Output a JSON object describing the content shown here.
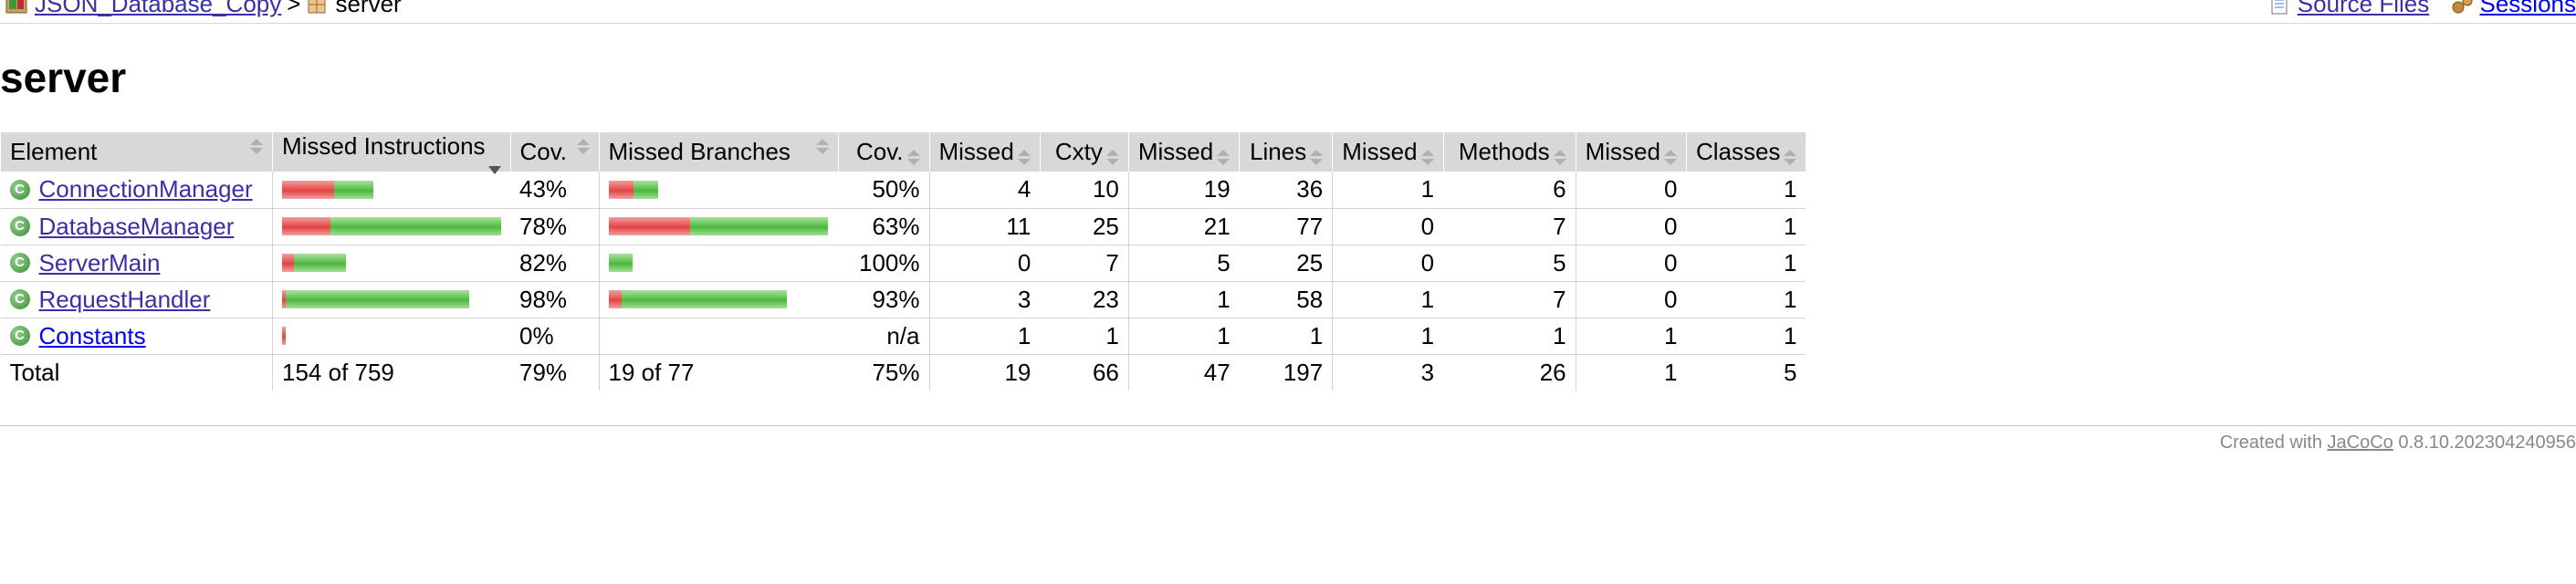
{
  "breadcrumb": {
    "project": "JSON_Database_Copy",
    "separator": ">",
    "current": "server",
    "source_files": "Source Files",
    "sessions": "Sessions"
  },
  "page_title": "server",
  "table": {
    "headers": [
      "Element",
      "Missed Instructions",
      "Cov.",
      "Missed Branches",
      "Cov.",
      "Missed",
      "Cxty",
      "Missed",
      "Lines",
      "Missed",
      "Methods",
      "Missed",
      "Classes"
    ],
    "rows": [
      {
        "name": "ConnectionManager",
        "instr_missed_frac": 0.57,
        "instr_cov": "43%",
        "br_missed_frac": 0.5,
        "br_cov": "50%",
        "cxty_missed": "4",
        "cxty": "10",
        "lines_missed": "19",
        "lines": "36",
        "methods_missed": "1",
        "methods": "6",
        "classes_missed": "0",
        "classes": "1",
        "visited": true
      },
      {
        "name": "DatabaseManager",
        "instr_missed_frac": 0.22,
        "instr_cov": "78%",
        "br_missed_frac": 0.37,
        "br_cov": "63%",
        "cxty_missed": "11",
        "cxty": "25",
        "lines_missed": "21",
        "lines": "77",
        "methods_missed": "0",
        "methods": "7",
        "classes_missed": "0",
        "classes": "1",
        "visited": true
      },
      {
        "name": "ServerMain",
        "instr_missed_frac": 0.18,
        "instr_cov": "82%",
        "br_missed_frac": 0.0,
        "br_cov": "100%",
        "cxty_missed": "0",
        "cxty": "7",
        "lines_missed": "5",
        "lines": "25",
        "methods_missed": "0",
        "methods": "5",
        "classes_missed": "0",
        "classes": "1",
        "visited": true
      },
      {
        "name": "RequestHandler",
        "instr_missed_frac": 0.02,
        "instr_cov": "98%",
        "br_missed_frac": 0.07,
        "br_cov": "93%",
        "cxty_missed": "3",
        "cxty": "23",
        "lines_missed": "1",
        "lines": "58",
        "methods_missed": "1",
        "methods": "7",
        "classes_missed": "0",
        "classes": "1",
        "visited": true
      },
      {
        "name": "Constants",
        "instr_missed_frac": 1.0,
        "instr_cov": "0%",
        "br_missed_frac": null,
        "br_cov": "n/a",
        "cxty_missed": "1",
        "cxty": "1",
        "lines_missed": "1",
        "lines": "1",
        "methods_missed": "1",
        "methods": "1",
        "classes_missed": "1",
        "classes": "1",
        "visited": false
      }
    ],
    "total": {
      "label": "Total",
      "instr": "154 of 759",
      "instr_cov": "79%",
      "br": "19 of 77",
      "br_cov": "75%",
      "cxty_missed": "19",
      "cxty": "66",
      "lines_missed": "47",
      "lines": "197",
      "methods_missed": "3",
      "methods": "26",
      "classes_missed": "1",
      "classes": "5"
    }
  },
  "footer": {
    "prefix": "Created with",
    "tool": "JaCoCo",
    "version": "0.8.10.202304240956"
  },
  "colors": {
    "missed": "#e24444",
    "covered": "#4cb83e",
    "header_bg": "#d8d8d8"
  }
}
